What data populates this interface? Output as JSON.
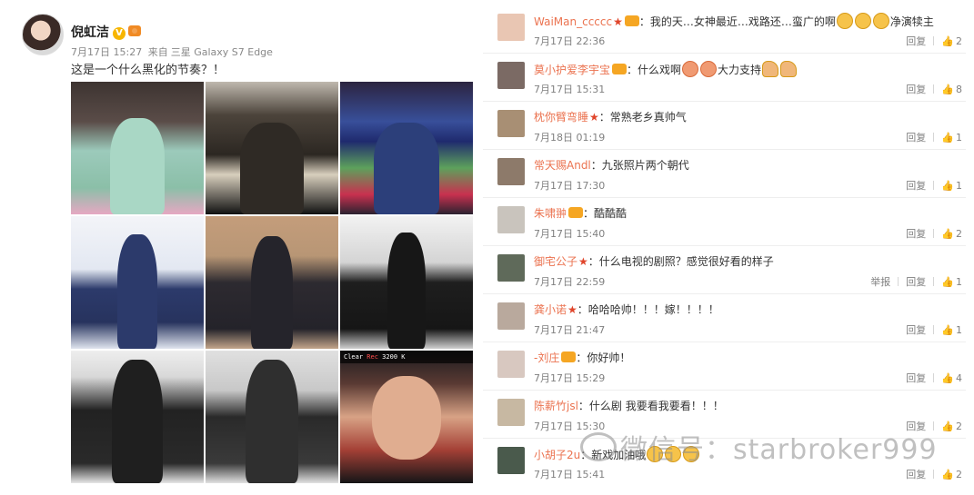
{
  "post": {
    "author": "倪虹洁",
    "date": "7月17日 15:27",
    "source_prefix": "来自",
    "source": "三星 Galaxy S7 Edge",
    "text": "这是一个什么黑化的节奏？！",
    "photos": [
      {
        "name": "qing-costume-teal"
      },
      {
        "name": "qing-costume-sepia"
      },
      {
        "name": "qing-costume-color"
      },
      {
        "name": "suit-blue-studio"
      },
      {
        "name": "suit-black-wall"
      },
      {
        "name": "suit-black-studio"
      },
      {
        "name": "suit-black-bw"
      },
      {
        "name": "suit-black-bw-2"
      },
      {
        "name": "camera-preview-closeup"
      }
    ],
    "camera_hud": {
      "clear": "Clear",
      "rec": "Rec",
      "kelvin": "3200 K"
    }
  },
  "comments": [
    {
      "name": "WaiMan_ccccc",
      "text": "：我的天…女神最近…戏路还…蛮广的啊",
      "tail": "净演犊主",
      "time": "7月17日 22:36",
      "reply": "回复",
      "likes": "2",
      "avatar_color": "#e9c6b3"
    },
    {
      "name": "莫小护爱李宇宝",
      "text": "：什么戏啊",
      "tail": "大力支持",
      "time": "7月17日 15:31",
      "reply": "回复",
      "likes": "8",
      "avatar_color": "#7b6a64"
    },
    {
      "name": "枕你臂弯睡",
      "text": "：常熟老乡真帅气",
      "tail": "",
      "time": "7月18日 01:19",
      "reply": "回复",
      "likes": "1",
      "avatar_color": "#a88f74"
    },
    {
      "name": "常天赐Andl",
      "text": "：九张照片两个朝代",
      "tail": "",
      "time": "7月17日 17:30",
      "reply": "回复",
      "likes": "1",
      "avatar_color": "#8d7a6a"
    },
    {
      "name": "朱啸翀",
      "text": "：酷酷酷",
      "tail": "",
      "time": "7月17日 15:40",
      "reply": "回复",
      "likes": "2",
      "avatar_color": "#c9c4bd"
    },
    {
      "name": "御宅公子",
      "text": "：什么电视的剧照？感觉很好看的样子",
      "tail": "",
      "time": "7月17日 22:59",
      "report": "举报",
      "reply": "回复",
      "likes": "1",
      "avatar_color": "#5f6a5a"
    },
    {
      "name": "龚小诺",
      "text": "：哈哈哈帅！！！嫁！！！！",
      "tail": "",
      "time": "7月17日 21:47",
      "reply": "回复",
      "likes": "1",
      "avatar_color": "#b9a99d"
    },
    {
      "name": "-刘庄",
      "text": "：你好帅！",
      "tail": "",
      "time": "7月17日 15:29",
      "reply": "回复",
      "likes": "4",
      "avatar_color": "#d8c8c0"
    },
    {
      "name": "陈薪竹jsl",
      "text": "：什么剧 我要看我要看！！！",
      "tail": "",
      "time": "7月17日 15:30",
      "reply": "回复",
      "likes": "2",
      "avatar_color": "#c7b8a2"
    },
    {
      "name": "小胡子2u",
      "text": "：新戏加油哦",
      "tail": "",
      "time": "7月17日 15:41",
      "reply": "回复",
      "likes": "2",
      "avatar_color": "#4a5a4c"
    }
  ],
  "watermark": "微信号：starbroker999",
  "like_icon": "👍",
  "colors": {
    "name_orange": "#eb7350",
    "meta_gray": "#808080"
  }
}
